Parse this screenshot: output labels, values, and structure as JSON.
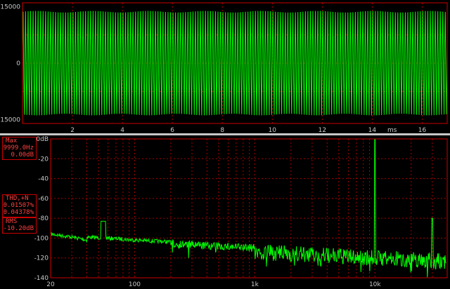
{
  "oscilloscope": {
    "y_ticks": [
      "15000",
      "0",
      "-15000"
    ],
    "x_ticks": [
      "2",
      "4",
      "6",
      "8",
      "10",
      "12",
      "14",
      "16"
    ],
    "x_unit": "ms"
  },
  "spectrum": {
    "y_ticks": [
      "0dB",
      "-20",
      "-40",
      "-60",
      "-80",
      "-100",
      "-120",
      "-140"
    ],
    "x_ticks": [
      "20",
      "100",
      "1k",
      "10k"
    ]
  },
  "readouts": {
    "max": {
      "title": "Max",
      "freq": "9999.0Hz",
      "level": "0.00dB"
    },
    "thd": {
      "title": "THD,+N",
      "value1": "0.01507%",
      "value2": "0.04378%"
    },
    "rms": {
      "title": "RMS",
      "value": "-10.20dB"
    }
  },
  "colors": {
    "trace": "#00ff00",
    "grid": "#aa0000",
    "frame": "#cc0000",
    "text": "#c8c8c8"
  },
  "chart_data": [
    {
      "type": "line",
      "title": "",
      "xlabel": "ms",
      "ylabel": "",
      "xlim": [
        0,
        17
      ],
      "ylim": [
        -16000,
        16000
      ],
      "series": [
        {
          "frequency_hz": 10000,
          "amplitude": 14500
        }
      ]
    },
    {
      "type": "line",
      "title": "",
      "xlabel": "",
      "ylabel": "dB",
      "x_scale": "log",
      "xlim": [
        20,
        20000
      ],
      "ylim": [
        -140,
        0
      ],
      "peaks": [
        {
          "x": 10000,
          "y": 0
        },
        {
          "x": 55,
          "y": -83
        },
        {
          "x": 30000,
          "y": -80
        }
      ],
      "noise_floor_db": -112
    }
  ]
}
